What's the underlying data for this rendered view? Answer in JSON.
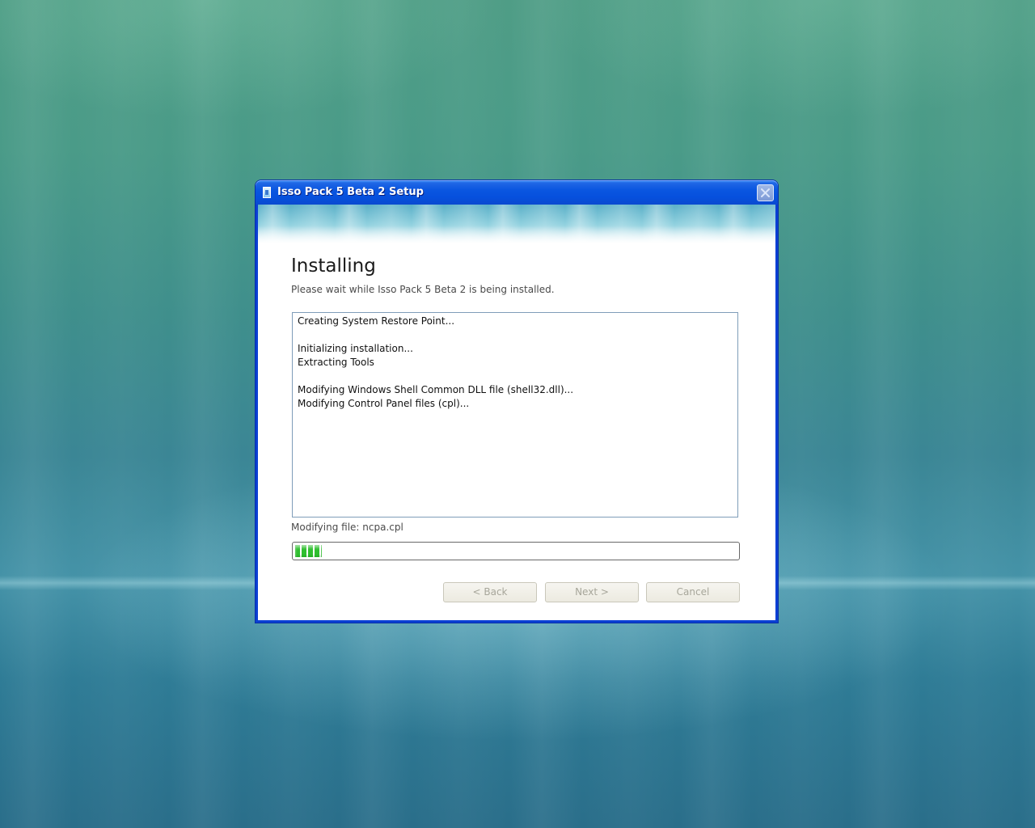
{
  "window": {
    "title": "Isso Pack 5 Beta 2 Setup",
    "close_label": "Close"
  },
  "page": {
    "heading": "Installing",
    "subheading": "Please wait while Isso Pack 5 Beta 2 is being installed."
  },
  "log": {
    "lines": [
      "Creating System Restore Point...",
      "",
      "Initializing installation...",
      "Extracting Tools",
      "",
      "Modifying Windows Shell Common DLL file (shell32.dll)...",
      "Modifying Control Panel files (cpl)..."
    ]
  },
  "status": {
    "current_action": "Modifying file: ncpa.cpl",
    "progress_percent": 6
  },
  "buttons": {
    "back": "< Back",
    "next": "Next >",
    "cancel": "Cancel"
  },
  "colors": {
    "titlebar": "#0650dd",
    "progress_fill": "#2fbf2f",
    "disabled_text": "#a7a69a"
  },
  "icons": {
    "app": "installer-icon",
    "close": "close-icon"
  }
}
